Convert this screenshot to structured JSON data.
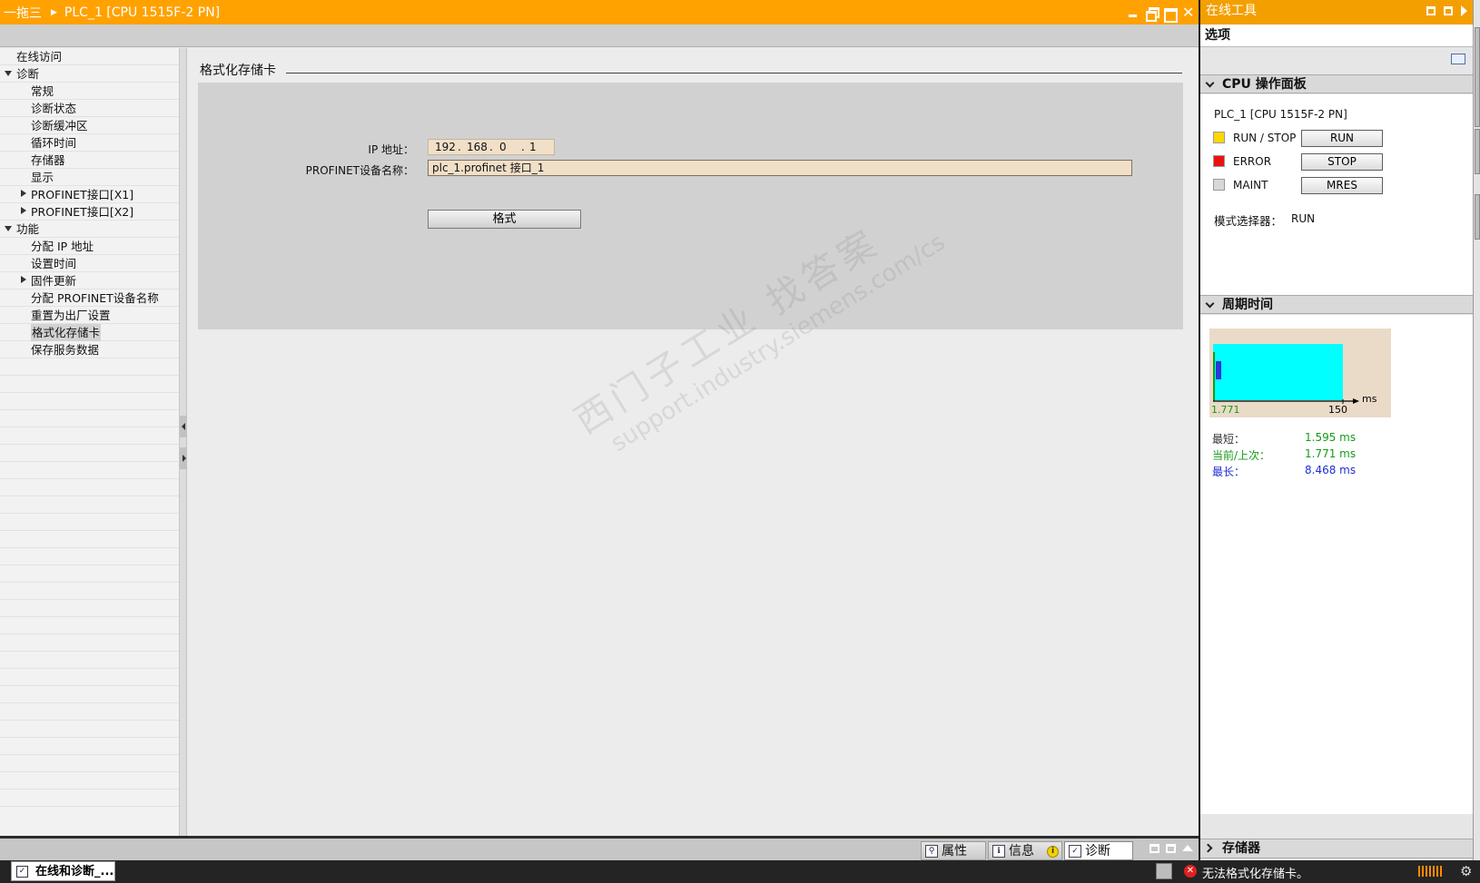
{
  "titlebar": {
    "breadcrumb_root": "一拖三",
    "breadcrumb_device": "PLC_1 [CPU 1515F-2 PN]"
  },
  "tree": {
    "items": [
      {
        "label": "在线访问",
        "level": 0,
        "toggle": "none",
        "selected": false
      },
      {
        "label": "诊断",
        "level": 0,
        "toggle": "open",
        "selected": false
      },
      {
        "label": "常规",
        "level": 1,
        "toggle": "none",
        "selected": false
      },
      {
        "label": "诊断状态",
        "level": 1,
        "toggle": "none",
        "selected": false
      },
      {
        "label": "诊断缓冲区",
        "level": 1,
        "toggle": "none",
        "selected": false
      },
      {
        "label": "循环时间",
        "level": 1,
        "toggle": "none",
        "selected": false
      },
      {
        "label": "存储器",
        "level": 1,
        "toggle": "none",
        "selected": false
      },
      {
        "label": "显示",
        "level": 1,
        "toggle": "none",
        "selected": false
      },
      {
        "label": "PROFINET接口[X1]",
        "level": 1,
        "toggle": "closed",
        "selected": false
      },
      {
        "label": "PROFINET接口[X2]",
        "level": 1,
        "toggle": "closed",
        "selected": false
      },
      {
        "label": "功能",
        "level": 0,
        "toggle": "open",
        "selected": false
      },
      {
        "label": "分配 IP 地址",
        "level": 1,
        "toggle": "none",
        "selected": false
      },
      {
        "label": "设置时间",
        "level": 1,
        "toggle": "none",
        "selected": false
      },
      {
        "label": "固件更新",
        "level": 1,
        "toggle": "closed",
        "selected": false
      },
      {
        "label": "分配 PROFINET设备名称",
        "level": 1,
        "toggle": "none",
        "selected": false
      },
      {
        "label": "重置为出厂设置",
        "level": 1,
        "toggle": "none",
        "selected": false
      },
      {
        "label": "格式化存储卡",
        "level": 1,
        "toggle": "none",
        "selected": true
      },
      {
        "label": "保存服务数据",
        "level": 1,
        "toggle": "none",
        "selected": false
      }
    ]
  },
  "main": {
    "section_title": "格式化存储卡",
    "ip_label": "IP 地址：",
    "ip_octets": [
      "192",
      "168",
      "0",
      "1"
    ],
    "ip_sep": ".",
    "name_label": "PROFINET设备名称：",
    "name_value": "plc_1.profinet 接口_1",
    "format_button": "格式"
  },
  "bottom_tabs": {
    "properties": "属性",
    "info": "信息",
    "info_badge": "i",
    "diagnostics": "诊断",
    "active": "diagnostics"
  },
  "statusbar": {
    "task_button": "在线和诊断_...",
    "message": "无法格式化存储卡。"
  },
  "right_panel": {
    "title": "在线工具",
    "options": "选项",
    "cpu_panel": {
      "header": "CPU 操作面板",
      "plc_name": "PLC_1 [CPU 1515F-2 PN]",
      "rows": [
        {
          "led_color": "#ffd700",
          "label": "RUN / STOP",
          "button": "RUN"
        },
        {
          "led_color": "#ee1111",
          "label": "ERROR",
          "button": "STOP"
        },
        {
          "led_color": "#d8d8d8",
          "label": "MAINT",
          "button": "MRES"
        }
      ],
      "mode_label": "模式选择器：",
      "mode_value": "RUN"
    },
    "cycle_time": {
      "header": "周期时间",
      "axis_start": "1.771",
      "axis_end": "150",
      "axis_unit": "ms",
      "min_label": "最短：",
      "min_value": "1.595 ms",
      "current_label": "当前/上次：",
      "current_value": "1.771 ms",
      "max_label": "最长：",
      "max_value": "8.468 ms",
      "colors": {
        "min": "#333333",
        "current": "#159a15",
        "max": "#1f2fd0",
        "area": "#00ffff"
      }
    },
    "storage_header": "存储器"
  },
  "watermark": {
    "line1": "西门子工业   找答案",
    "line2": "support.industry.siemens.com/cs"
  }
}
